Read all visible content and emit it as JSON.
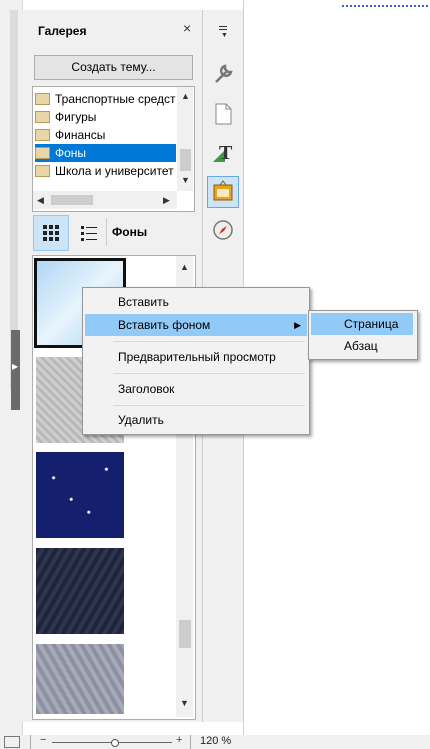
{
  "gallery": {
    "title": "Галерея",
    "close_glyph": "×",
    "create_theme": "Создать тему...",
    "themes": [
      {
        "label": "Транспортные средства",
        "selected": false
      },
      {
        "label": "Фигуры",
        "selected": false
      },
      {
        "label": "Финансы",
        "selected": false
      },
      {
        "label": "Фоны",
        "selected": true
      },
      {
        "label": "Школа и университет",
        "selected": false
      }
    ],
    "current_theme": "Фоны",
    "view_icon_glyph": "⠿",
    "view_list_glyph": "☰"
  },
  "context_menu": {
    "items": [
      "Вставить",
      "Вставить фоном",
      "Предварительный просмотр",
      "Заголовок",
      "Удалить"
    ],
    "submenu": [
      "Страница",
      "Абзац"
    ]
  },
  "sidebar_tabs": [
    "properties-icon",
    "page-icon",
    "styles-icon",
    "gallery-icon",
    "navigator-icon"
  ],
  "status": {
    "zoom": "120 %",
    "zoom_minus": "−",
    "zoom_plus": "+"
  }
}
